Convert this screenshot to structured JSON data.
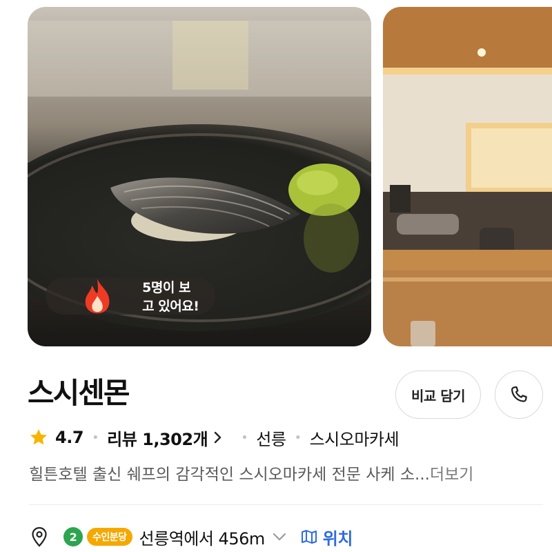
{
  "gallery": {
    "viewing_badge": "5명이 보고 있어요!"
  },
  "restaurant": {
    "name": "스시센몬",
    "compare_label": "비교 담기",
    "rating": "4.7",
    "reviews_label": "리뷰 1,302개",
    "area": "선릉",
    "category": "스시오마카세",
    "description": "힐튼호텔 출신 쉐프의 감각적인 스시오마카세 전문 사케 소...",
    "more_label": "더보기"
  },
  "location": {
    "line_number": "2",
    "line_name": "수인분당",
    "distance_text": "선릉역에서 456m",
    "map_label": "위치"
  },
  "colors": {
    "star": "#f7b500",
    "line2": "#2ea44f",
    "suin_bundang": "#f5a800",
    "link_blue": "#2d6be0"
  }
}
